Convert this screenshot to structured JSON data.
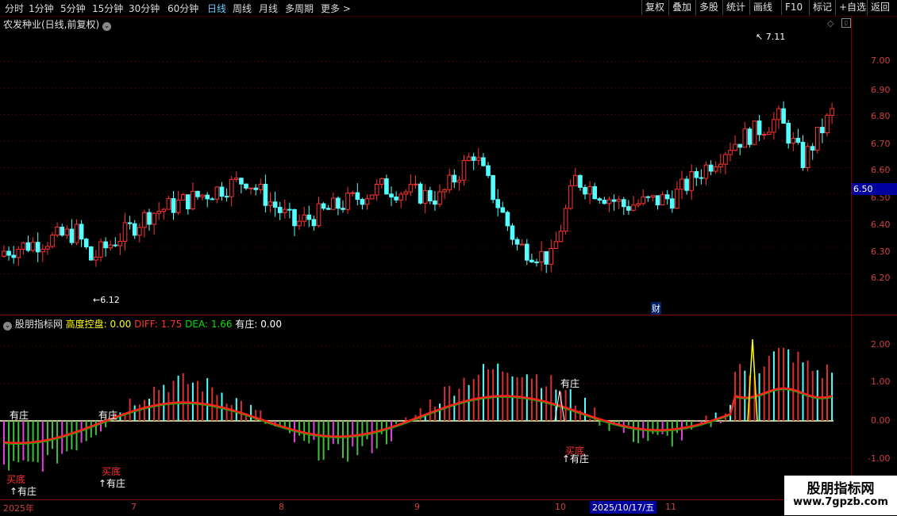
{
  "toolbar": {
    "periods": [
      "分时",
      "1分钟",
      "5分钟",
      "15分钟",
      "30分钟",
      "60分钟",
      "日线",
      "周线",
      "月线",
      "多周期",
      "更多"
    ],
    "active_period": "日线",
    "buttons": [
      "复权",
      "叠加",
      "多股",
      "统计",
      "画线",
      "F10",
      "+自选",
      "返回"
    ],
    "extra_button": "标记"
  },
  "price_panel": {
    "title": "农发种业(日线,前复权)",
    "y_ticks": [
      "7.00",
      "6.90",
      "6.80",
      "6.70",
      "6.60",
      "6.50",
      "6.40",
      "6.30",
      "6.20"
    ],
    "current_price_tag": "6.50",
    "high_annotation": "7.11",
    "low_annotation": "6.12",
    "event_marker": "财",
    "colors": {
      "up": "#ff3232",
      "down": "#54ffff",
      "grid": "#7a0000",
      "tag_bg": "#0000a0"
    }
  },
  "indicator_panel": {
    "name": "股朋指标网",
    "fields": [
      {
        "label": "高度控盘: 0.00",
        "color": "#ffff00"
      },
      {
        "label": "DIFF: 1.75",
        "color": "#ff3232"
      },
      {
        "label": "DEA: 1.66",
        "color": "#00e000"
      },
      {
        "label": "有庄: 0.00",
        "color": "#ffffff"
      }
    ],
    "y_ticks": [
      "2.00",
      "1.00",
      "0.00",
      "-1.00"
    ],
    "annotations": {
      "youzhuang": "有庄",
      "maidi": "买底",
      "up_youzhuang": "↑有庄"
    }
  },
  "x_axis": {
    "year_label": "2025年",
    "months": [
      "7",
      "8",
      "9",
      "10",
      "11"
    ],
    "cursor_date": "2025/10/17/五"
  },
  "watermark": {
    "title": "股朋指标网",
    "url": "www.7gpzb.com"
  }
}
